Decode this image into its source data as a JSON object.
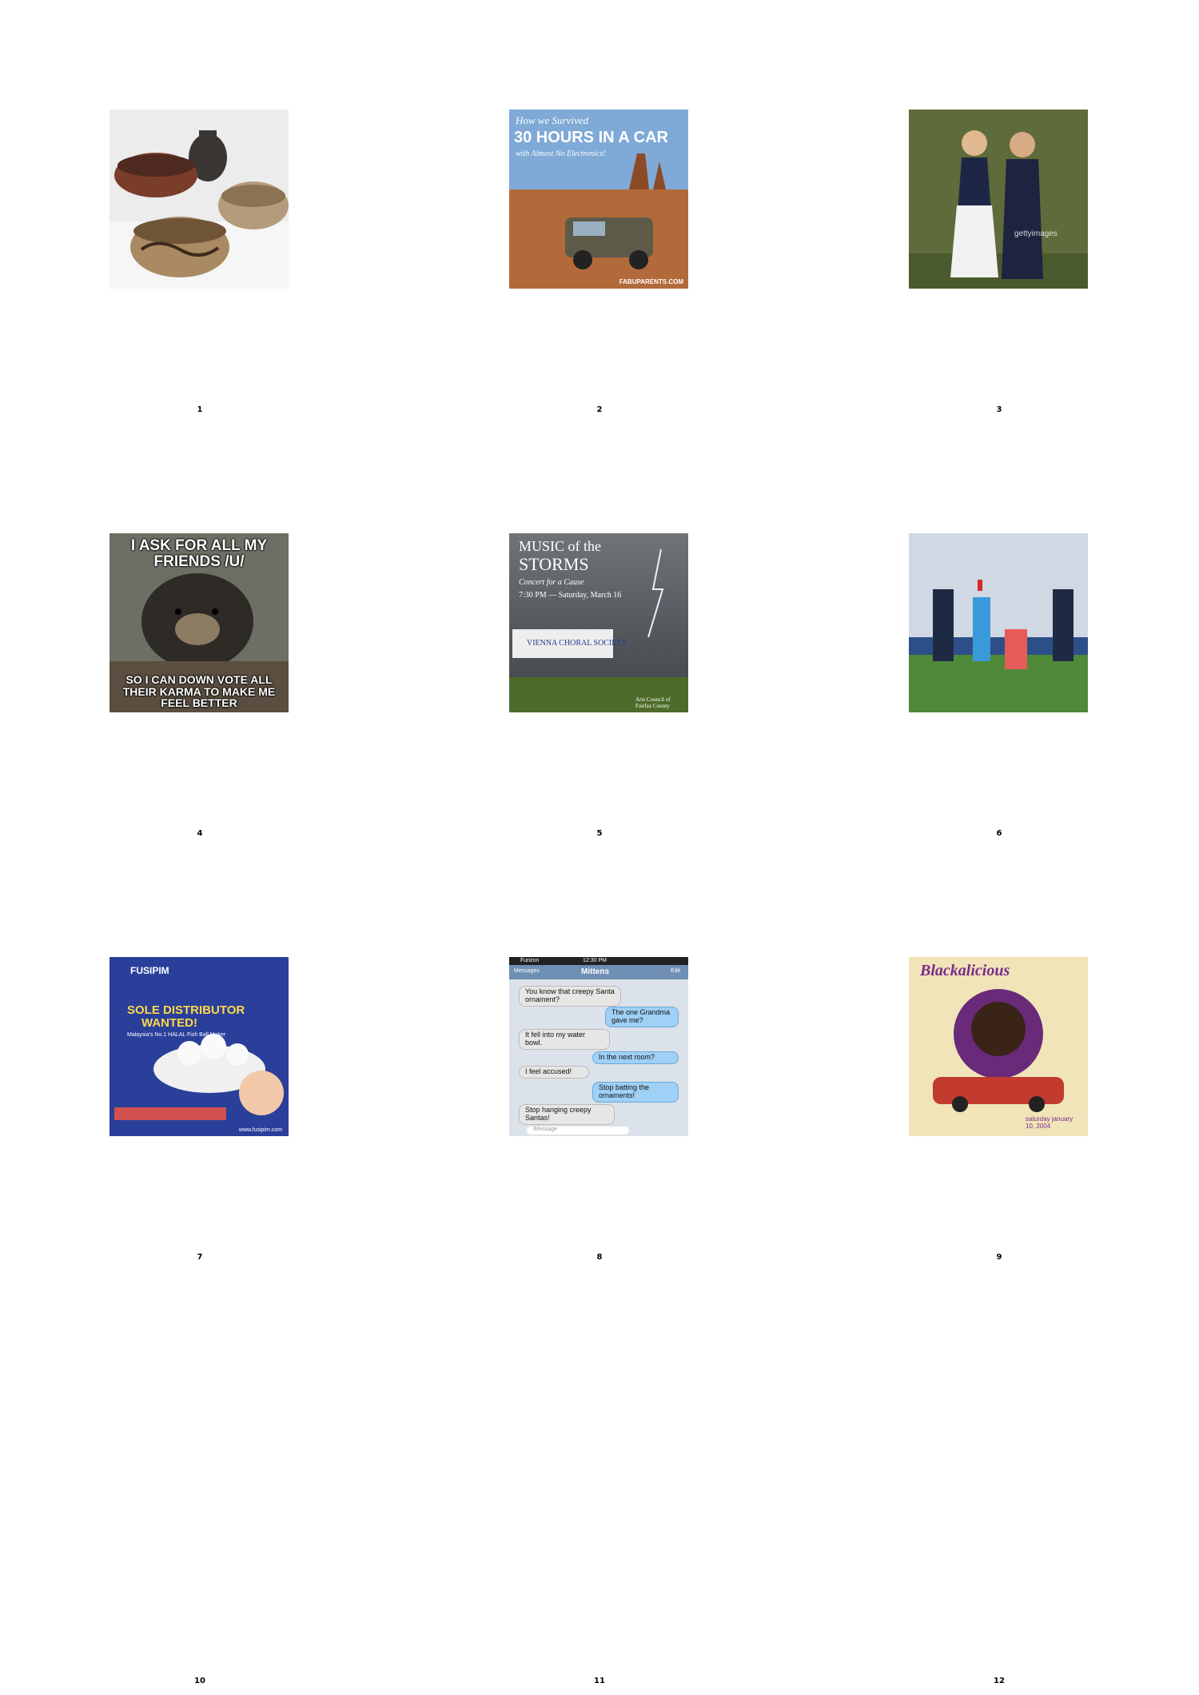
{
  "cells": [
    {
      "number": "1",
      "alt": "clay-pottery-bowls-photo"
    },
    {
      "number": "2",
      "headline_top": "How we Survived",
      "headline_main": "30 HOURS IN A CAR",
      "headline_sub": "with Almost No Electronics!",
      "site": "FABUPARENTS.COM"
    },
    {
      "number": "3",
      "watermark": "gettyimages"
    },
    {
      "number": "4",
      "top_text": "I ASK FOR ALL MY FRIENDS /U/",
      "bottom_text": "SO I CAN DOWN VOTE ALL THEIR KARMA TO MAKE ME FEEL BETTER"
    },
    {
      "number": "5",
      "title_line1": "MUSIC of the",
      "title_line2": "STORMS",
      "subtitle": "Concert for a Cause",
      "date": "7:30 PM — Saturday, March 16",
      "org": "VIENNA CHORAL SOCIETY",
      "sponsor": "Arts Council of Fairfax County"
    },
    {
      "number": "6"
    },
    {
      "number": "7",
      "brand": "FUSIPIM",
      "headline_line1": "SOLE DISTRIBUTOR",
      "headline_line2": "WANTED!",
      "tagline": "Malaysia's No.1 HALAL Fish Ball Maker",
      "site": "www.fusipim.com"
    },
    {
      "number": "8",
      "carrier": "Furizon",
      "time": "12:30 PM",
      "back": "Messages",
      "contact": "Mittens",
      "edit": "Edit",
      "messages": [
        {
          "dir": "in",
          "text": "You know that creepy Santa ornament?"
        },
        {
          "dir": "out",
          "text": "The one Grandma gave me?"
        },
        {
          "dir": "in",
          "text": "It fell into my water bowl."
        },
        {
          "dir": "out",
          "text": "In the next room?"
        },
        {
          "dir": "in",
          "text": "I feel accused!"
        },
        {
          "dir": "out",
          "text": "Stop batting the ornaments!"
        },
        {
          "dir": "in",
          "text": "Stop hanging creepy Santas!"
        }
      ],
      "input_placeholder": "iMessage"
    },
    {
      "number": "9",
      "title": "Blackalicious",
      "date_line": "saturday january 10, 2004"
    },
    {
      "number": "10"
    },
    {
      "number": "11"
    },
    {
      "number": "12"
    }
  ]
}
